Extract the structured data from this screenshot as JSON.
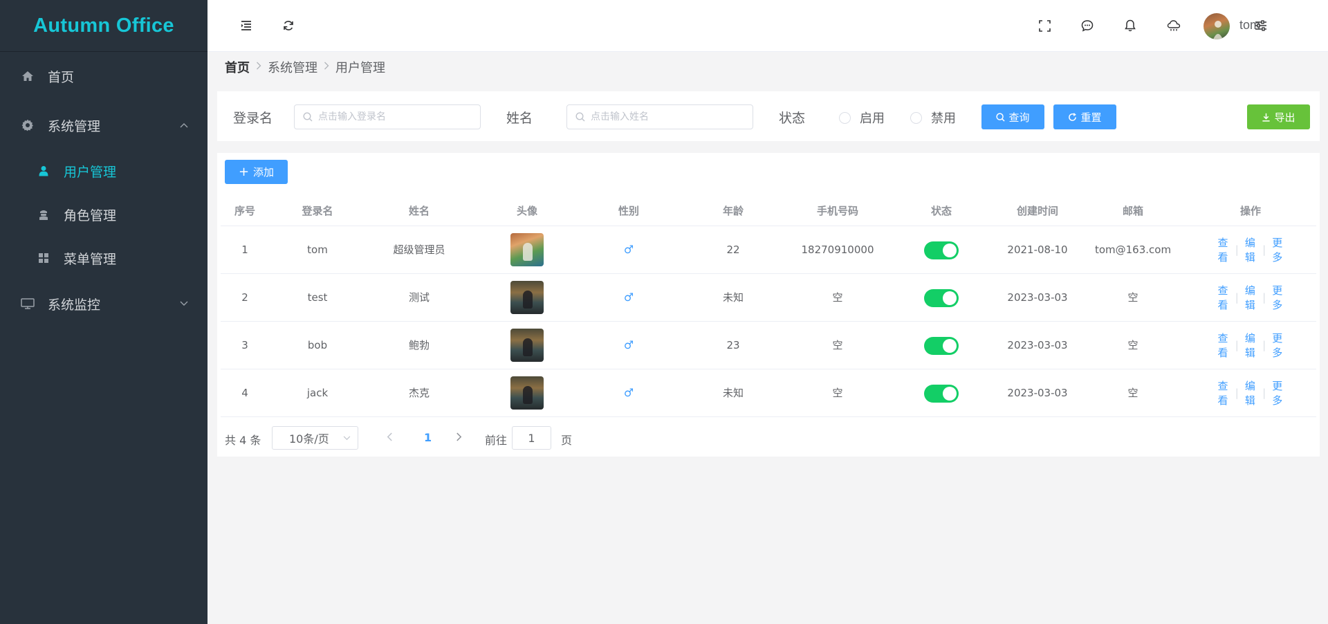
{
  "app": {
    "title": "Autumn Office"
  },
  "sidebar": {
    "items": [
      {
        "label": "首页",
        "icon": "home-icon"
      },
      {
        "label": "系统管理",
        "icon": "gear-icon",
        "expanded": true
      },
      {
        "label": "用户管理",
        "icon": "user-icon",
        "active": true
      },
      {
        "label": "角色管理",
        "icon": "role-icon"
      },
      {
        "label": "菜单管理",
        "icon": "grid-icon"
      },
      {
        "label": "系统监控",
        "icon": "monitor-icon",
        "expanded": false
      }
    ]
  },
  "header": {
    "username": "tom",
    "icons": [
      "menu-fold-icon",
      "refresh-icon",
      "fullscreen-icon",
      "message-icon",
      "bell-icon",
      "weather-icon",
      "settings-sliders-icon"
    ]
  },
  "breadcrumb": [
    "首页",
    "系统管理",
    "用户管理"
  ],
  "search": {
    "login_label": "登录名",
    "login_placeholder": "点击输入登录名",
    "name_label": "姓名",
    "name_placeholder": "点击输入姓名",
    "status_label": "状态",
    "status_options": [
      "启用",
      "禁用"
    ],
    "query_label": "查询",
    "reset_label": "重置",
    "export_label": "导出"
  },
  "toolbar": {
    "add_label": "添加"
  },
  "table": {
    "columns": [
      "序号",
      "登录名",
      "姓名",
      "头像",
      "性别",
      "年龄",
      "手机号码",
      "状态",
      "创建时间",
      "邮箱",
      "操作"
    ],
    "rows": [
      {
        "index": "1",
        "login": "tom",
        "name": "超级管理员",
        "gender": "♂",
        "age": "22",
        "phone": "18270910000",
        "status_on": true,
        "created": "2021-08-10",
        "email": "tom@163.com"
      },
      {
        "index": "2",
        "login": "test",
        "name": "测试",
        "gender": "♂",
        "age": "未知",
        "phone": "空",
        "status_on": true,
        "created": "2023-03-03",
        "email": "空"
      },
      {
        "index": "3",
        "login": "bob",
        "name": "鲍勃",
        "gender": "♂",
        "age": "23",
        "phone": "空",
        "status_on": true,
        "created": "2023-03-03",
        "email": "空"
      },
      {
        "index": "4",
        "login": "jack",
        "name": "杰克",
        "gender": "♂",
        "age": "未知",
        "phone": "空",
        "status_on": true,
        "created": "2023-03-03",
        "email": "空"
      }
    ],
    "actions": [
      "查看",
      "编辑",
      "更多"
    ]
  },
  "pagination": {
    "total_text": "共 4 条",
    "page_size": "10条/页",
    "current_page": "1",
    "goto_label": "前往",
    "goto_value": "1",
    "page_unit": "页"
  },
  "colors": {
    "sidebar_bg": "#28323c",
    "accent": "#17c6d6",
    "primary": "#409eff",
    "success": "#67c23a",
    "switch_on": "#13ce66"
  }
}
